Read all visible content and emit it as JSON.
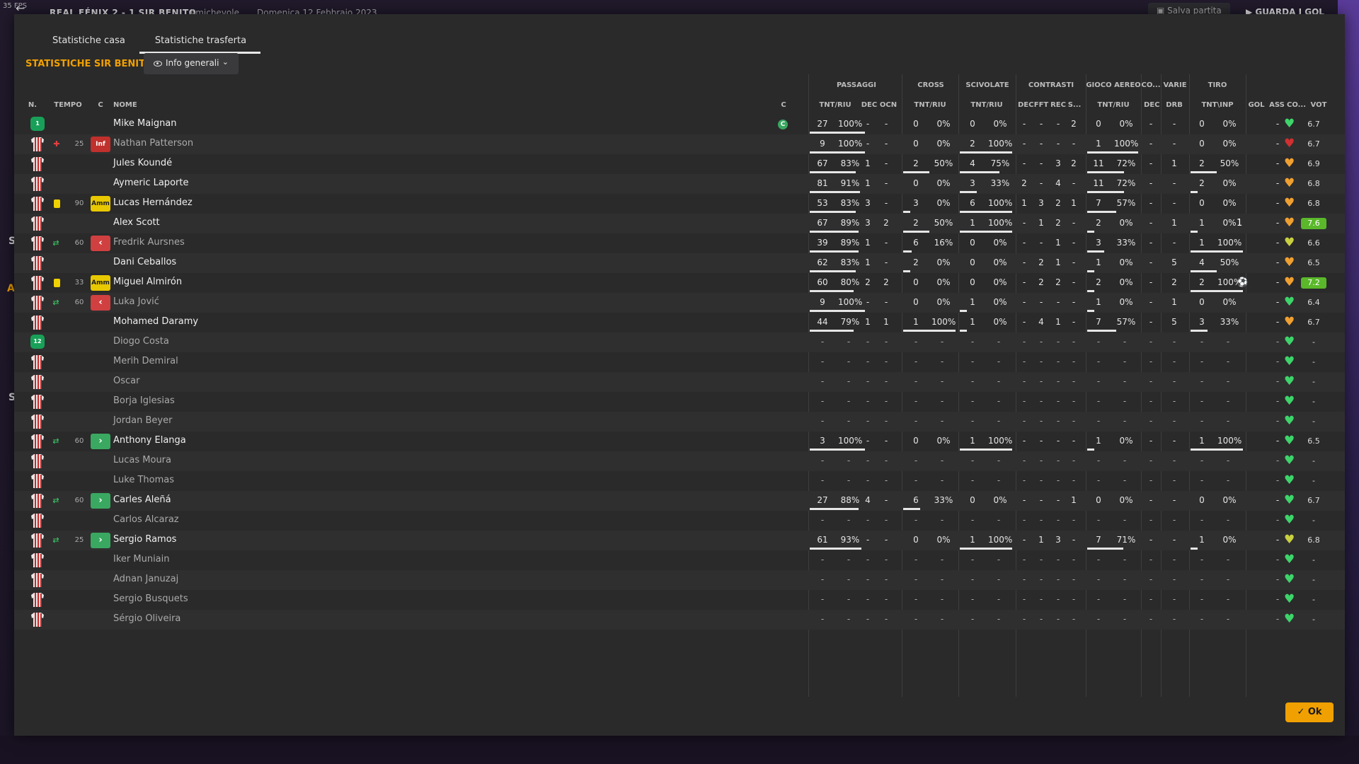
{
  "topbar": {
    "fps": "35 FPS",
    "match": "REAL FÉNIX 2 - 1 SIR BENITO",
    "competition": "Amichevole",
    "date": "Domenica 12 Febbraio 2023",
    "save_label": "Salva partita",
    "watch_label": "GUARDA I GOL"
  },
  "side_letters": [
    "S",
    "A",
    "S"
  ],
  "tabs": [
    {
      "label": "Statistiche casa",
      "active": false
    },
    {
      "label": "Statistiche trasferta",
      "active": true
    }
  ],
  "team_title": "STATISTICHE SIR BENITO",
  "view_dropdown": "Info generali",
  "ok_label": "Ok",
  "groups": [
    "PASSAGGI",
    "CROSS",
    "SCIVOLATE",
    "CONTRASTI",
    "GIOCO AEREO",
    "CO...",
    "VARIE",
    "TIRO"
  ],
  "headers": {
    "n": "N.",
    "tempo": "TEMPO",
    "c": "C",
    "nome": "NOME",
    "c2": "C",
    "pass_tr": "TNT/RIU",
    "dec": "DEC",
    "ocn": "OCN",
    "cross_tr": "TNT/RIU",
    "sciv_tr": "TNT/RIU",
    "c_dec": "DEC",
    "c_fft": "FFT",
    "c_rec": "REC",
    "c_s": "S...",
    "aer_tr": "TNT/RIU",
    "co_dec": "DEC",
    "drb": "DRB",
    "tiro": "TNT\\INP",
    "gol": "GOL",
    "ass": "ASS",
    "co": "CO...",
    "vot": "VOT"
  },
  "players": [
    {
      "num": "1",
      "gk": true,
      "name": "Mike Maignan",
      "captain": "C",
      "pass": [
        27,
        "100%"
      ],
      "dec": "-",
      "ocn": "-",
      "cross": [
        0,
        "0%"
      ],
      "sciv": [
        0,
        "0%"
      ],
      "con": [
        "-",
        "-",
        "-",
        "2"
      ],
      "aer": [
        0,
        "0%"
      ],
      "codec": "-",
      "drb": "-",
      "tiro": [
        0,
        "0%"
      ],
      "ass": "-",
      "heart": "green",
      "vote": "6.7"
    },
    {
      "name": "Nathan Patterson",
      "dim": true,
      "event": "injury",
      "tempo": "25",
      "badge": "Inf",
      "pass": [
        9,
        "100%"
      ],
      "dec": "-",
      "ocn": "-",
      "cross": [
        0,
        "0%"
      ],
      "sciv": [
        2,
        "100%"
      ],
      "con": [
        "-",
        "-",
        "-",
        "-"
      ],
      "aer": [
        1,
        "100%"
      ],
      "codec": "-",
      "drb": "-",
      "tiro": [
        0,
        "0%"
      ],
      "ass": "-",
      "heart": "red",
      "vote": "6.7"
    },
    {
      "name": "Jules Koundé",
      "pass": [
        67,
        "83%"
      ],
      "dec": "1",
      "ocn": "-",
      "cross": [
        2,
        "50%"
      ],
      "sciv": [
        4,
        "75%"
      ],
      "con": [
        "-",
        "-",
        "3",
        "2"
      ],
      "aer": [
        11,
        "72%"
      ],
      "codec": "-",
      "drb": "1",
      "tiro": [
        2,
        "50%"
      ],
      "ass": "-",
      "heart": "orange",
      "vote": "6.9"
    },
    {
      "name": "Aymeric Laporte",
      "pass": [
        81,
        "91%"
      ],
      "dec": "1",
      "ocn": "-",
      "cross": [
        0,
        "0%"
      ],
      "sciv": [
        3,
        "33%"
      ],
      "con": [
        "2",
        "-",
        "4",
        "-"
      ],
      "aer": [
        11,
        "72%"
      ],
      "codec": "-",
      "drb": "-",
      "tiro": [
        2,
        "0%"
      ],
      "ass": "-",
      "heart": "orange",
      "vote": "6.8"
    },
    {
      "name": "Lucas Hernández",
      "event": "yellow",
      "tempo": "90",
      "badge": "Amm",
      "pass": [
        53,
        "83%"
      ],
      "dec": "3",
      "ocn": "-",
      "cross": [
        3,
        "0%"
      ],
      "sciv": [
        6,
        "100%"
      ],
      "con": [
        "1",
        "3",
        "2",
        "1"
      ],
      "aer": [
        7,
        "57%"
      ],
      "codec": "-",
      "drb": "-",
      "tiro": [
        0,
        "0%"
      ],
      "ass": "-",
      "heart": "orange",
      "vote": "6.8"
    },
    {
      "name": "Alex Scott",
      "pass": [
        67,
        "89%"
      ],
      "dec": "3",
      "ocn": "2",
      "cross": [
        2,
        "50%"
      ],
      "sciv": [
        1,
        "100%"
      ],
      "con": [
        "-",
        "1",
        "2",
        "-"
      ],
      "aer": [
        2,
        "0%"
      ],
      "codec": "-",
      "drb": "1",
      "tiro": [
        1,
        "0%"
      ],
      "gol": "1",
      "ass": "-",
      "heart": "orange",
      "vote": "7.6",
      "vote_hi": true
    },
    {
      "name": "Fredrik Aursnes",
      "dim": true,
      "event": "sub",
      "tempo": "60",
      "badge": "out",
      "pass": [
        39,
        "89%"
      ],
      "dec": "1",
      "ocn": "-",
      "cross": [
        6,
        "16%"
      ],
      "sciv": [
        0,
        "0%"
      ],
      "con": [
        "-",
        "-",
        "1",
        "-"
      ],
      "aer": [
        3,
        "33%"
      ],
      "codec": "-",
      "drb": "-",
      "tiro": [
        1,
        "100%"
      ],
      "ass": "-",
      "heart": "yellow",
      "vote": "6.6"
    },
    {
      "name": "Dani Ceballos",
      "pass": [
        62,
        "83%"
      ],
      "dec": "1",
      "ocn": "-",
      "cross": [
        2,
        "0%"
      ],
      "sciv": [
        0,
        "0%"
      ],
      "con": [
        "-",
        "2",
        "1",
        "-"
      ],
      "aer": [
        1,
        "0%"
      ],
      "codec": "-",
      "drb": "5",
      "tiro": [
        4,
        "50%"
      ],
      "ass": "-",
      "heart": "orange",
      "vote": "6.5"
    },
    {
      "name": "Miguel Almirón",
      "event": "yellow",
      "tempo": "33",
      "badge": "Amm",
      "pass": [
        60,
        "80%"
      ],
      "dec": "2",
      "ocn": "2",
      "cross": [
        0,
        "0%"
      ],
      "sciv": [
        0,
        "0%"
      ],
      "con": [
        "-",
        "2",
        "2",
        "-"
      ],
      "aer": [
        2,
        "0%"
      ],
      "codec": "-",
      "drb": "2",
      "tiro": [
        2,
        "100%"
      ],
      "gol": "⚽",
      "ass": "-",
      "heart": "orange",
      "vote": "7.2",
      "vote_hi": true
    },
    {
      "name": "Luka Jović",
      "dim": true,
      "event": "sub",
      "tempo": "60",
      "badge": "out",
      "pass": [
        9,
        "100%"
      ],
      "dec": "-",
      "ocn": "-",
      "cross": [
        0,
        "0%"
      ],
      "sciv": [
        1,
        "0%"
      ],
      "con": [
        "-",
        "-",
        "-",
        "-"
      ],
      "aer": [
        1,
        "0%"
      ],
      "codec": "-",
      "drb": "1",
      "tiro": [
        0,
        "0%"
      ],
      "ass": "-",
      "heart": "green",
      "vote": "6.4"
    },
    {
      "name": "Mohamed Daramy",
      "pass": [
        44,
        "79%"
      ],
      "dec": "1",
      "ocn": "1",
      "cross": [
        1,
        "100%"
      ],
      "sciv": [
        1,
        "0%"
      ],
      "con": [
        "-",
        "4",
        "1",
        "-"
      ],
      "aer": [
        7,
        "57%"
      ],
      "codec": "-",
      "drb": "5",
      "tiro": [
        3,
        "33%"
      ],
      "ass": "-",
      "heart": "orange",
      "vote": "6.7"
    },
    {
      "num": "12",
      "gk": true,
      "name": "Diogo Costa",
      "dim": true,
      "empty": true,
      "heart": "green",
      "vote": "-"
    },
    {
      "name": "Merih Demiral",
      "dim": true,
      "empty": true,
      "heart": "green",
      "vote": "-"
    },
    {
      "name": "Oscar",
      "dim": true,
      "empty": true,
      "heart": "green",
      "vote": "-"
    },
    {
      "name": "Borja Iglesias",
      "dim": true,
      "empty": true,
      "heart": "green",
      "vote": "-"
    },
    {
      "name": "Jordan Beyer",
      "dim": true,
      "empty": true,
      "heart": "green",
      "vote": "-"
    },
    {
      "name": "Anthony Elanga",
      "event": "sub",
      "tempo": "60",
      "badge": "in",
      "pass": [
        3,
        "100%"
      ],
      "dec": "-",
      "ocn": "-",
      "cross": [
        0,
        "0%"
      ],
      "sciv": [
        1,
        "100%"
      ],
      "con": [
        "-",
        "-",
        "-",
        "-"
      ],
      "aer": [
        1,
        "0%"
      ],
      "codec": "-",
      "drb": "-",
      "tiro": [
        1,
        "100%"
      ],
      "ass": "-",
      "heart": "green",
      "vote": "6.5"
    },
    {
      "name": "Lucas Moura",
      "dim": true,
      "empty": true,
      "heart": "green",
      "vote": "-"
    },
    {
      "name": "Luke Thomas",
      "dim": true,
      "empty": true,
      "heart": "green",
      "vote": "-"
    },
    {
      "name": "Carles Aleñá",
      "event": "sub",
      "tempo": "60",
      "badge": "in",
      "pass": [
        27,
        "88%"
      ],
      "dec": "4",
      "ocn": "-",
      "cross": [
        6,
        "33%"
      ],
      "sciv": [
        0,
        "0%"
      ],
      "con": [
        "-",
        "-",
        "-",
        "1"
      ],
      "aer": [
        0,
        "0%"
      ],
      "codec": "-",
      "drb": "-",
      "tiro": [
        0,
        "0%"
      ],
      "ass": "-",
      "heart": "green",
      "vote": "6.7"
    },
    {
      "name": "Carlos Alcaraz",
      "dim": true,
      "empty": true,
      "heart": "green",
      "vote": "-"
    },
    {
      "name": "Sergio Ramos",
      "event": "sub",
      "tempo": "25",
      "badge": "in",
      "pass": [
        61,
        "93%"
      ],
      "dec": "-",
      "ocn": "-",
      "cross": [
        0,
        "0%"
      ],
      "sciv": [
        1,
        "100%"
      ],
      "con": [
        "-",
        "1",
        "3",
        "-"
      ],
      "aer": [
        7,
        "71%"
      ],
      "codec": "-",
      "drb": "-",
      "tiro": [
        1,
        "0%"
      ],
      "ass": "-",
      "heart": "yellow",
      "vote": "6.8"
    },
    {
      "name": "Iker Muniain",
      "dim": true,
      "empty": true,
      "heart": "green",
      "vote": "-"
    },
    {
      "name": "Adnan Januzaj",
      "dim": true,
      "empty": true,
      "heart": "green",
      "vote": "-"
    },
    {
      "name": "Sergio Busquets",
      "dim": true,
      "empty": true,
      "heart": "green",
      "vote": "-"
    },
    {
      "name": "Sérgio Oliveira",
      "dim": true,
      "empty": true,
      "heart": "green",
      "vote": "-"
    }
  ],
  "colors": {
    "accent": "#f0a000",
    "green": "#3ed46a",
    "orange": "#f0a030",
    "red": "#d03030",
    "yellow": "#c8d040",
    "vote_hi": "#5ab82a"
  }
}
